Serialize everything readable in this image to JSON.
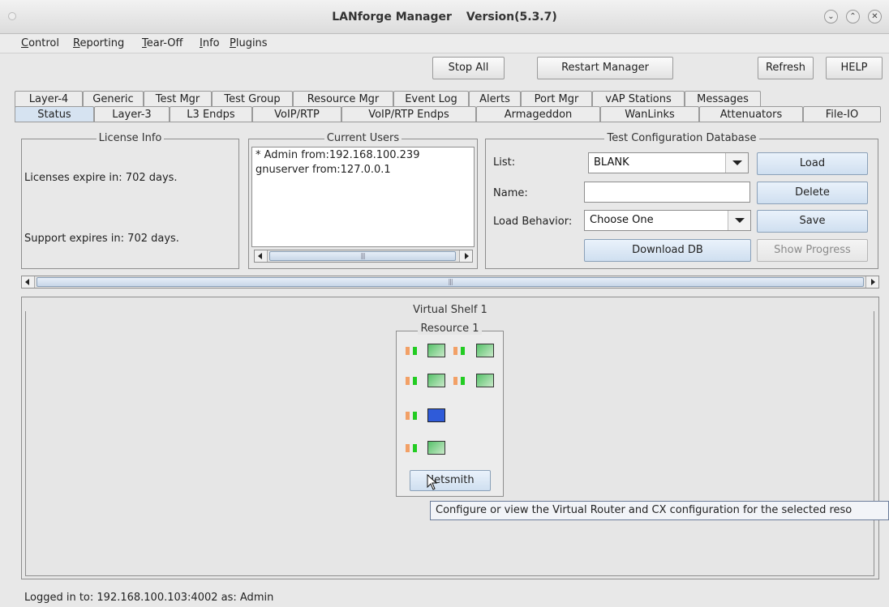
{
  "window": {
    "title": "LANforge Manager",
    "version": "Version(5.3.7)",
    "minimize_glyph": "⌄",
    "maximize_glyph": "⌃",
    "close_glyph": "✕"
  },
  "menu": [
    {
      "u": "C",
      "rest": "ontrol"
    },
    {
      "u": "R",
      "rest": "eporting"
    },
    {
      "u": "T",
      "rest": "ear-Off"
    },
    {
      "u": "I",
      "rest": "nfo"
    },
    {
      "u": "P",
      "rest": "lugins"
    }
  ],
  "toolbar": {
    "stop_all": "Stop All",
    "restart_manager": "Restart Manager",
    "refresh": "Refresh",
    "help": "HELP"
  },
  "tabs_row1": [
    "Layer-4",
    "Generic",
    "Test Mgr",
    "Test Group",
    "Resource Mgr",
    "Event Log",
    "Alerts",
    "Port Mgr",
    "vAP Stations",
    "Messages"
  ],
  "tabs_row2": [
    "Status",
    "Layer-3",
    "L3 Endps",
    "VoIP/RTP",
    "VoIP/RTP Endps",
    "Armageddon",
    "WanLinks",
    "Attenuators",
    "File-IO"
  ],
  "active_tab": "Status",
  "license": {
    "title": "License Info",
    "licenses": "Licenses expire in: 702 days.",
    "support": "Support expires in: 702 days."
  },
  "users": {
    "title": "Current Users",
    "lines": [
      "* Admin from:192.168.100.239",
      "gnuserver from:127.0.0.1"
    ]
  },
  "db": {
    "title": "Test Configuration Database",
    "list_label": "List:",
    "list_value": "BLANK",
    "name_label": "Name:",
    "name_value": "",
    "behavior_label": "Load Behavior:",
    "behavior_value": "Choose One",
    "load": "Load",
    "delete": "Delete",
    "save": "Save",
    "download": "Download DB",
    "show_progress": "Show Progress"
  },
  "shelf": {
    "title": "Virtual Shelf 1",
    "resource_title": "Resource 1",
    "netsmith": "Netsmith"
  },
  "tooltip": "Configure or view the Virtual Router and CX configuration for the selected reso",
  "status": "Logged in to:  192.168.100.103:4002  as:  Admin"
}
